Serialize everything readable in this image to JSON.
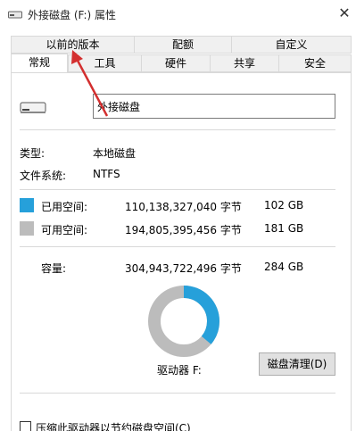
{
  "window": {
    "title": "外接磁盘 (F:) 属性",
    "close_glyph": "✕"
  },
  "tabs": {
    "row1": [
      "以前的版本",
      "配额",
      "自定义"
    ],
    "row2": [
      "常规",
      "工具",
      "硬件",
      "共享",
      "安全"
    ],
    "active": "常规"
  },
  "general": {
    "volume_name": "外接磁盘",
    "type_label": "类型:",
    "type_value": "本地磁盘",
    "fs_label": "文件系统:",
    "fs_value": "NTFS",
    "used": {
      "label": "已用空间:",
      "bytes": "110,138,327,040 字节",
      "size": "102 GB",
      "color": "#26a0da"
    },
    "free": {
      "label": "可用空间:",
      "bytes": "194,805,395,456 字节",
      "size": "181 GB",
      "color": "#bcbcbc"
    },
    "capacity": {
      "label": "容量:",
      "bytes": "304,943,722,496 字节",
      "size": "284 GB"
    },
    "used_fraction": 0.361,
    "drive_label": "驱动器 F:",
    "cleanup_button": "磁盘清理(D)",
    "compress_checkbox": "压缩此驱动器以节约磁盘空间(C)",
    "compress_checked": false
  },
  "annotation": {
    "arrow_color": "#d32f2f"
  }
}
